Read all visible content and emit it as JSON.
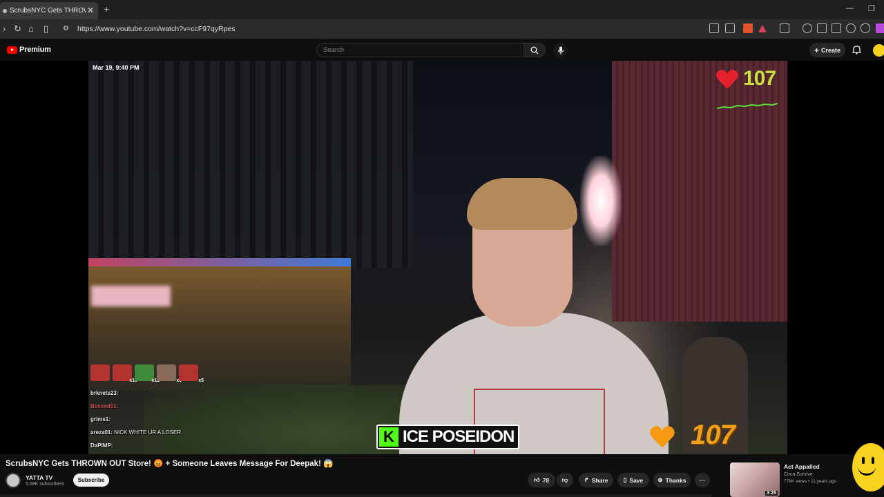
{
  "browser": {
    "tab_title": "ScrubsNYC Gets THROWN OUT",
    "url": "https://www.youtube.com/watch?v=ccF97qyRpes"
  },
  "header": {
    "logo_text": "Premium",
    "search_placeholder": "Search",
    "create_label": "Create"
  },
  "player": {
    "timestamp": "Mar 19, 9:40 PM",
    "hp_top": "107",
    "hp_bottom": "107",
    "streamer_name": "ICE POSEIDON",
    "emote_counts": [
      "x10",
      "x12",
      "x6",
      "x5"
    ],
    "chat": [
      {
        "user": "brknets23:",
        "msg": ""
      },
      {
        "user": "Bossed01:",
        "msg": ""
      },
      {
        "user": "grims1:",
        "msg": ""
      },
      {
        "user": "areza01:",
        "msg": "NICK WHITE UR A LOSER"
      },
      {
        "user": "DaPIMP:",
        "msg": ""
      }
    ]
  },
  "video": {
    "title": "ScrubsNYC Gets THROWN OUT Store! 😡 + Someone Leaves Message For Deepak! 😱",
    "channel_name": "YATTA TV",
    "subscribers": "5.68K subscribers",
    "subscribe_label": "Subscribe",
    "like_count": "78",
    "share_label": "Share",
    "save_label": "Save",
    "thanks_label": "Thanks",
    "more_label": "···"
  },
  "recommended": {
    "title": "Act Appalled",
    "artist": "Circa Survive",
    "meta": "776K views • 11 years ago",
    "duration": "3:25"
  },
  "colors": {
    "youtube_red": "#ff0000",
    "kick_green": "#53fc18",
    "hp_yellow": "#c7e23a",
    "hp_orange": "#f0a018"
  }
}
